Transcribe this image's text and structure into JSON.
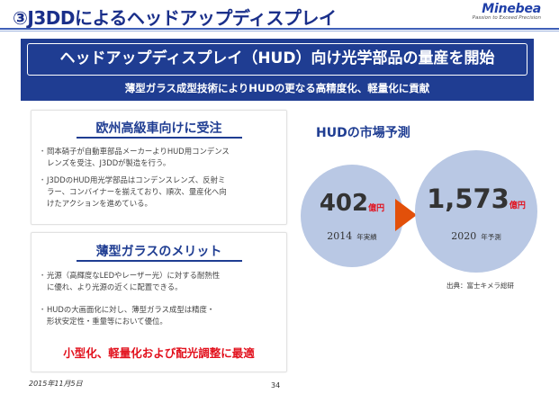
{
  "header": {
    "title": "③J3DDによるヘッドアップディスプレイ",
    "logo_name": "Minebea",
    "logo_tagline": "Passion to Exceed Precision"
  },
  "banner": {
    "headline": "ヘッドアップディスプレイ（HUD）向け光学部品の量産を開始",
    "subline": "薄型ガラス成型技術によりHUDの更なる高精度化、軽量化に貢献"
  },
  "panel1": {
    "title": "欧州高級車向けに受注",
    "bullets": [
      {
        "lines": [
          "岡本硝子が自動車部品メーカーよりHUD用コンデンス",
          "レンズを受注、J3DDが製造を行う。"
        ]
      },
      {
        "lines": [
          "J3DDのHUD用光学部品はコンデンスレンズ、反射ミ",
          "ラー、コンバイナーを揃えており、順次、量産化へ向",
          "けたアクションを進めている。"
        ]
      }
    ]
  },
  "panel2": {
    "title": "薄型ガラスのメリット",
    "bullets": [
      {
        "lines": [
          "光源（高輝度なLEDやレーザー光）に対する耐熱性",
          "に優れ、より光源の近くに配置できる。"
        ]
      },
      {
        "lines": [
          "HUDの大画面化に対し、薄型ガラス成型は精度・",
          "形状安定性・重量等において優位。"
        ]
      }
    ],
    "highlight": "小型化、軽量化および配光調整に最適"
  },
  "market": {
    "title": "HUDの市場予測",
    "current": {
      "value": "402",
      "unit": "億円",
      "year": "2014",
      "label": "年実績"
    },
    "forecast": {
      "value": "1,573",
      "unit": "億円",
      "year": "2020",
      "label": "年予測"
    },
    "source": "出典：富士キメラ総研"
  },
  "footer": {
    "date": "2015年11月5日",
    "page": "34"
  },
  "colors": {
    "brand_blue": "#1f3d92",
    "accent_red": "#e2101c",
    "arrow_orange": "#e2500a",
    "circle_fill": "#b9c8e4"
  }
}
